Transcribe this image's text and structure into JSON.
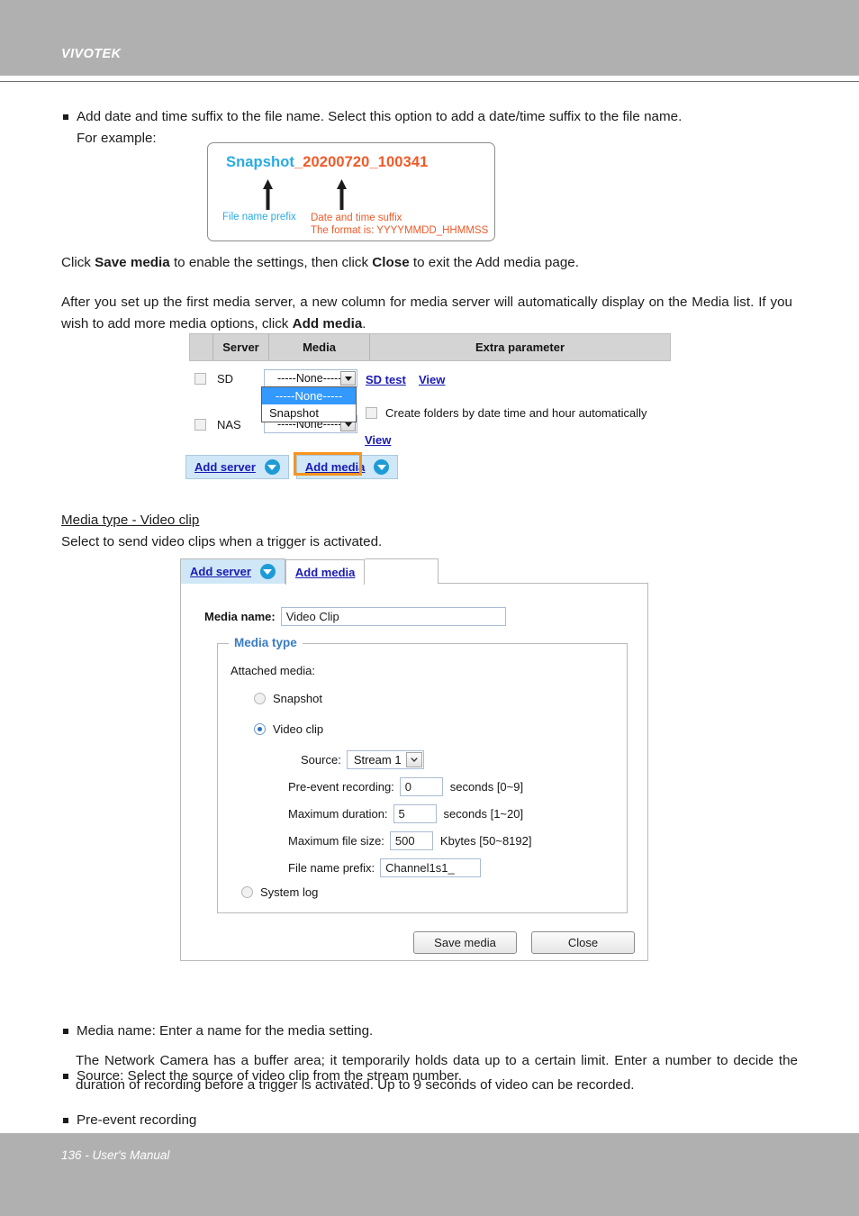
{
  "header": {
    "brand": "VIVOTEK"
  },
  "footer": {
    "text": "136 - User's Manual"
  },
  "intro": {
    "bullet_1_main": "Add date and time suffix to the file name. Select this option to add a date/time suffix to the file name.",
    "bullet_1_cont": "For example:"
  },
  "example": {
    "filename_prefix": "Snapshot",
    "filename_suffix": "_20200720_100341",
    "label_prefix": "File name prefix",
    "label_suffix_line1": "Date and time suffix",
    "label_suffix_line2": "The format is: YYYYMMDD_HHMMSS",
    "color_prefix": "#29abe2",
    "color_suffix": "#f05a28"
  },
  "paragraphs": {
    "p1_a": "Click ",
    "p1_b": "Save media",
    "p1_c": " to enable the settings, then click ",
    "p1_d": "Close",
    "p1_e": " to exit the Add media page.",
    "p2_a": "After you set up the first media server, a new column for media server will automatically display on the Media list. If you wish to add more media options, click ",
    "p2_b": "Add media",
    "p2_c": "."
  },
  "media_table": {
    "columns": [
      "",
      "Server",
      "Media",
      "Extra parameter"
    ],
    "rows": [
      {
        "server": "SD",
        "media_value": "-----None-----",
        "links": [
          "SD test",
          "View"
        ]
      },
      {
        "server": "NAS",
        "media_value": "-----None-----",
        "links": [
          "View"
        ]
      }
    ],
    "dropdown_open_options": [
      "-----None-----",
      "Snapshot"
    ],
    "dropdown_selected": "-----None-----",
    "create_folders_label": "Create folders by date time and hour automatically",
    "sd_test_label": "SD test",
    "view_label": "View",
    "add_server_label": "Add server",
    "add_media_label": "Add media",
    "highlight_color": "#f7941e"
  },
  "section": {
    "heading": "Media type - Video clip",
    "subtext": "Select to send video clips when a trigger is activated."
  },
  "panel": {
    "tabs": [
      {
        "label": "Add server",
        "active": false
      },
      {
        "label": "Add media",
        "active": true
      }
    ],
    "media_name_label": "Media name:",
    "media_name_value": "Video Clip",
    "fieldset_legend": "Media type",
    "attached_media_label": "Attached media:",
    "options": {
      "snapshot": "Snapshot",
      "video_clip": "Video clip",
      "system_log": "System log",
      "selected": "Video clip"
    },
    "fields": {
      "source_label": "Source:",
      "source_value": "Stream 1",
      "pre_event_label": "Pre-event recording:",
      "pre_event_value": "0",
      "pre_event_suffix": "seconds [0~9]",
      "max_duration_label": "Maximum duration:",
      "max_duration_value": "5",
      "max_duration_suffix": "seconds [1~20]",
      "max_file_size_label": "Maximum file size:",
      "max_file_size_value": "500",
      "max_file_size_suffix": "Kbytes [50~8192]",
      "file_name_prefix_label": "File name prefix:",
      "file_name_prefix_value": "Channel1s1_"
    },
    "buttons": {
      "save": "Save media",
      "close": "Close"
    }
  },
  "notes": {
    "b1": "Media name: Enter a name for the media setting.",
    "b2": "Source: Select the source of video clip from the stream number.",
    "b3": "Pre-event recording",
    "b3_body": "The Network Camera has a buffer area; it temporarily holds data up to a certain limit. Enter a number to decide the duration of recording before a trigger is activated. Up to 9 seconds of video can be recorded."
  }
}
